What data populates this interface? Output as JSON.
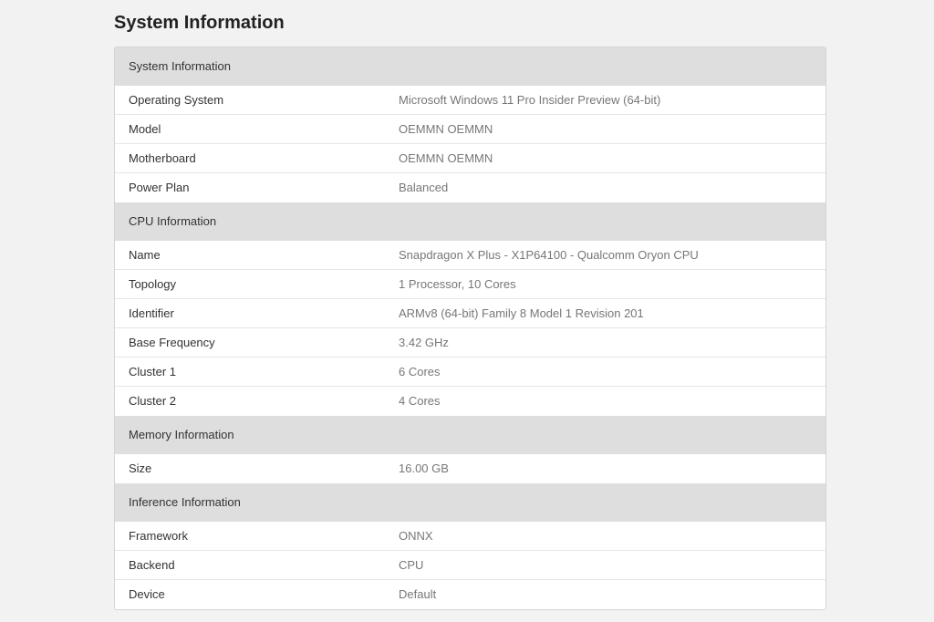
{
  "page": {
    "title": "System Information"
  },
  "sections": [
    {
      "header": "System Information",
      "rows": [
        {
          "key": "Operating System",
          "value": "Microsoft Windows 11 Pro Insider Preview (64-bit)"
        },
        {
          "key": "Model",
          "value": "OEMMN OEMMN"
        },
        {
          "key": "Motherboard",
          "value": "OEMMN OEMMN"
        },
        {
          "key": "Power Plan",
          "value": "Balanced"
        }
      ]
    },
    {
      "header": "CPU Information",
      "rows": [
        {
          "key": "Name",
          "value": "Snapdragon X Plus - X1P64100 - Qualcomm Oryon CPU"
        },
        {
          "key": "Topology",
          "value": "1 Processor, 10 Cores"
        },
        {
          "key": "Identifier",
          "value": "ARMv8 (64-bit) Family 8 Model 1 Revision 201"
        },
        {
          "key": "Base Frequency",
          "value": "3.42 GHz"
        },
        {
          "key": "Cluster 1",
          "value": "6 Cores"
        },
        {
          "key": "Cluster 2",
          "value": "4 Cores"
        }
      ]
    },
    {
      "header": "Memory Information",
      "rows": [
        {
          "key": "Size",
          "value": "16.00 GB"
        }
      ]
    },
    {
      "header": "Inference Information",
      "rows": [
        {
          "key": "Framework",
          "value": "ONNX"
        },
        {
          "key": "Backend",
          "value": "CPU"
        },
        {
          "key": "Device",
          "value": "Default"
        }
      ]
    }
  ],
  "colors": {
    "background": "#f2f2f2",
    "section_header_bg": "#dedede",
    "key_text": "#333333",
    "value_text": "#777777"
  }
}
